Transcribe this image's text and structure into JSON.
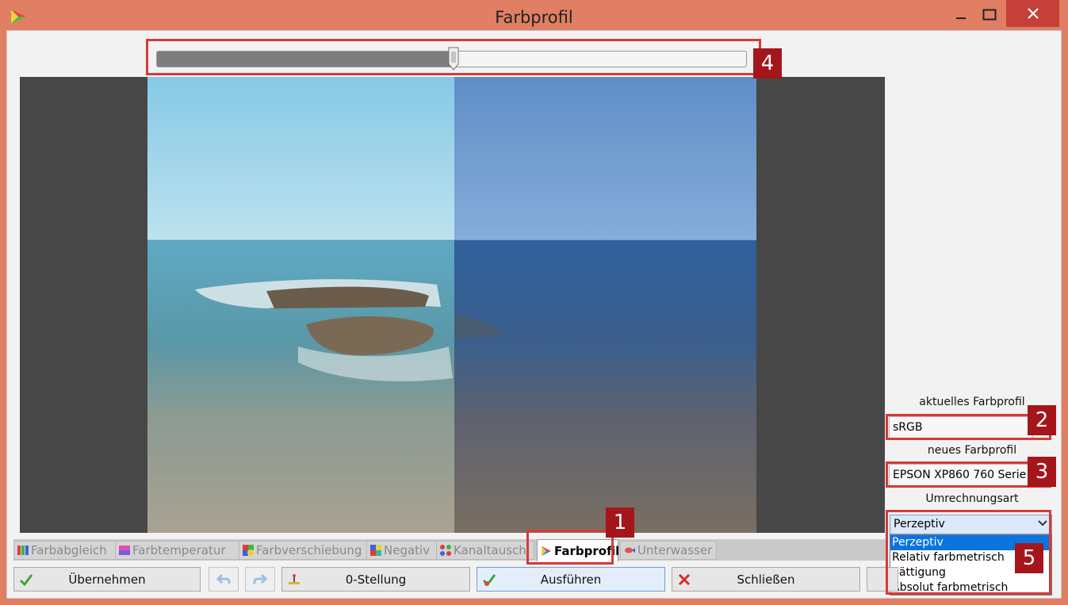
{
  "window": {
    "title": "Farbprofil"
  },
  "slider": {
    "value_fraction": 0.505
  },
  "right_panel": {
    "current_profile_label": "aktuelles Farbprofil",
    "current_profile_value": "sRGB",
    "new_profile_label": "neues Farbprofil",
    "new_profile_value": "EPSON XP860 760 Serie",
    "conversion_label": "Umrechnungsart",
    "conversion_selected": "Perzeptiv",
    "conversion_options": [
      "Perzeptiv",
      "Relativ farbmetrisch",
      "Sättigung",
      "Absolut farbmetrisch"
    ]
  },
  "tabs": [
    {
      "label": "Farbabgleich",
      "icon": "rgb-bars-icon",
      "active": false
    },
    {
      "label": "Farbtemperatur",
      "icon": "temperature-icon",
      "active": false
    },
    {
      "label": "Farbverschiebung",
      "icon": "color-shift-icon",
      "active": false
    },
    {
      "label": "Negativ",
      "icon": "negative-icon",
      "active": false
    },
    {
      "label": "Kanaltausch",
      "icon": "channel-swap-icon",
      "active": false
    },
    {
      "label": "Farbprofil",
      "icon": "color-profile-icon",
      "active": true
    },
    {
      "label": "Unterwasser",
      "icon": "fish-icon",
      "active": false
    }
  ],
  "buttons": {
    "apply": "Übernehmen",
    "reset": "0-Stellung",
    "execute": "Ausführen",
    "close": "Schließen"
  },
  "annotations": [
    "1",
    "2",
    "3",
    "4",
    "5"
  ],
  "colors": {
    "frame": "#e07f63",
    "annotation_red": "#a5161b",
    "selection_blue": "#0a74e0"
  }
}
